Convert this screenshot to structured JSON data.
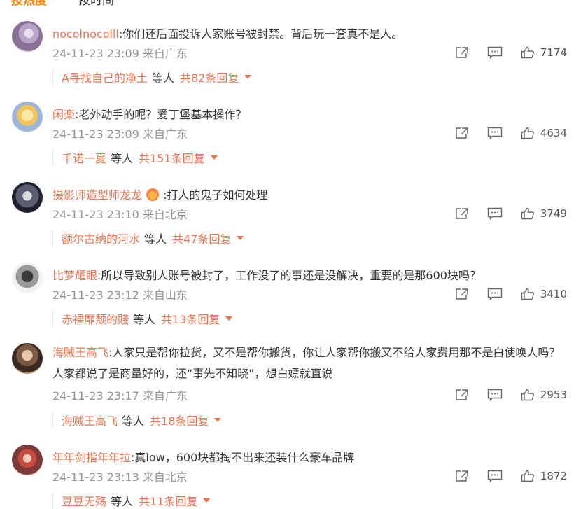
{
  "sort": {
    "hot": "按热度",
    "time": "按时间"
  },
  "comments": [
    {
      "user": "nocolnocolll",
      "text": ":你们还后面投诉人家账号被封禁。背后玩一套真不是人。",
      "date": "24-11-23 23:09",
      "source": "来自广东",
      "likes": "7174",
      "reply_user": "A寻找自己的净土",
      "reply_mid": "等人",
      "reply_count": "共82条回复"
    },
    {
      "user": "闲楽",
      "text": ":老外动手的呢？爱丁堡基本操作？",
      "date": "24-11-23 23:09",
      "source": "来自广东",
      "likes": "4634",
      "reply_user": "千诺一夏",
      "reply_mid": "等人",
      "reply_count": "共151条回复"
    },
    {
      "user": "摄影师造型师龙龙",
      "text": ":打人的鬼子如何处理",
      "date": "24-11-23 23:10",
      "source": "来自北京",
      "likes": "3749",
      "reply_user": "额尔古纳的河水",
      "reply_mid": "等人",
      "reply_count": "共47条回复"
    },
    {
      "user": "比梦耀眼",
      "text": ":所以导致别人账号被封了，工作没了的事还是没解决，重要的是那600块吗？",
      "date": "24-11-23 23:12",
      "source": "来自山东",
      "likes": "3410",
      "reply_user": "赤裸靡颓的賤",
      "reply_mid": "等人",
      "reply_count": "共13条回复"
    },
    {
      "user": "海贼王高飞",
      "text": ":人家只是帮你拉货，又不是帮你搬货，你让人家帮你搬又不给人家费用那不是白使唤人吗？人家都说了是商量好的，还“事先不知晓”，想白嫖就直说",
      "date": "24-11-23 23:17",
      "source": "来自广东",
      "likes": "2953",
      "reply_user": "海贼王高飞",
      "reply_mid": "等人",
      "reply_count": "共18条回复"
    },
    {
      "user": "年年剑指年年拉",
      "text": ":真low，600块都掏不出来还装什么豪车品牌",
      "date": "24-11-23 23:13",
      "source": "来自北京",
      "likes": "1872",
      "reply_user": "豆豆无殇",
      "reply_mid": "等人",
      "reply_count": "共11条回复"
    }
  ],
  "colors": {
    "accent": "#ff8200",
    "username": "#eb7350",
    "meta": "#939393"
  },
  "icons": {
    "share": "share-icon",
    "comment": "comment-icon",
    "like": "like-icon",
    "expand": "caret-down-icon"
  }
}
